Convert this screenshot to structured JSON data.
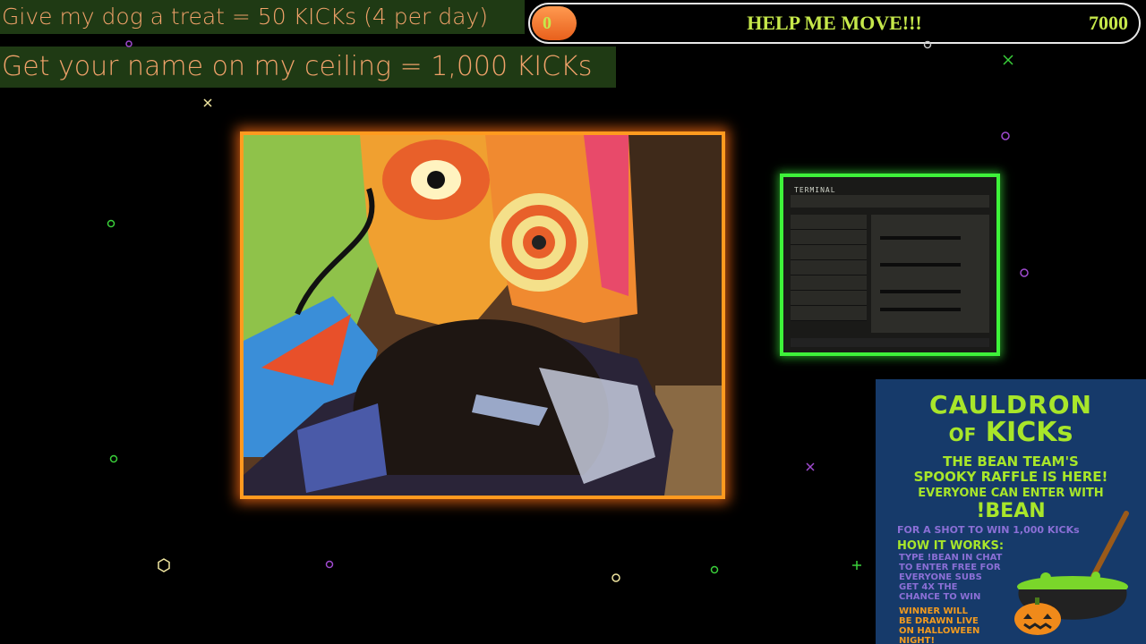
{
  "banners": {
    "dog_treat": "Give my dog a treat = 50 KICKs (4 per day)",
    "ceiling": "Get your name on my ceiling = 1,000 KICKs"
  },
  "goal": {
    "current": "0",
    "title": "HELP ME MOVE!!!",
    "target": "7000",
    "progress_percent": 0,
    "colors": {
      "fill": "#f07a2a",
      "text": "#c6e84a",
      "border": "#e8e8e8"
    }
  },
  "webcam": {
    "border_color": "#ff9a1f"
  },
  "game_capture": {
    "title": "TERMINAL",
    "border_color": "#3ef23a"
  },
  "poster": {
    "title_line1": "CAULDRON",
    "title_line2_small": "OF",
    "title_line2_big": "KICKs",
    "sub1": "THE BEAN TEAM'S",
    "sub2": "SPOOKY RAFFLE IS HERE!",
    "sub3": "EVERYONE CAN ENTER WITH",
    "command": "!BEAN",
    "shot": "FOR A SHOT TO WIN 1,000 KICKs",
    "how_title": "HOW IT WORKS:",
    "how_lines": [
      "TYPE !BEAN IN CHAT",
      "TO ENTER FREE FOR",
      "EVERYONE SUBS",
      "GET 4X THE",
      "CHANCE TO WIN"
    ],
    "winner_lines": [
      "WINNER WILL",
      "BE DRAWN LIVE",
      "ON HALLOWEEN",
      "NIGHT!"
    ],
    "colors": {
      "background": "#163a6a",
      "green": "#a8e62a",
      "purple": "#8b6fd6",
      "orange": "#f09a20"
    }
  }
}
